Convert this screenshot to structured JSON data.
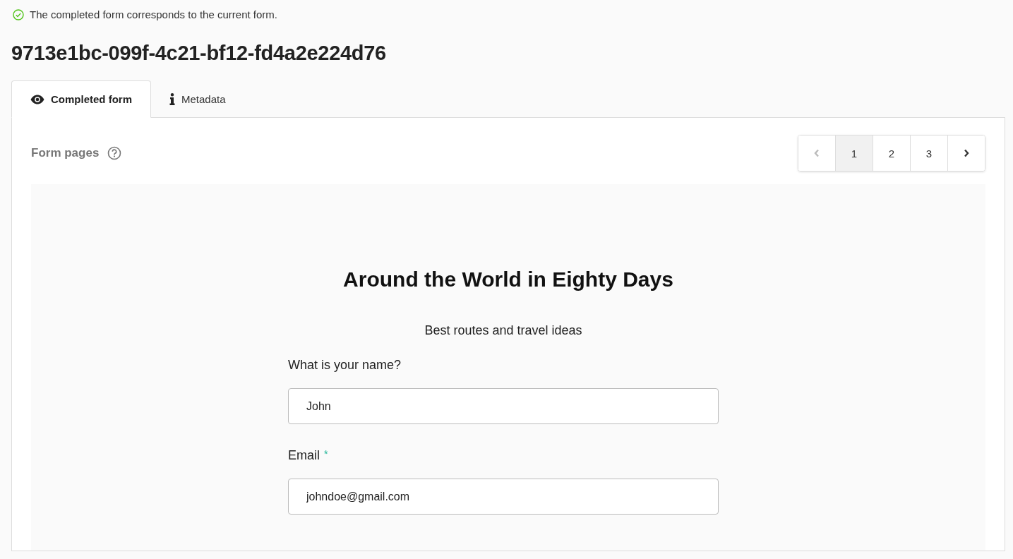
{
  "status": {
    "kind": "success",
    "text": "The completed form corresponds to the current form."
  },
  "title": "9713e1bc-099f-4c21-bf12-fd4a2e224d76",
  "tabs": [
    {
      "label": "Completed form",
      "kind": "eye",
      "selected": true
    },
    {
      "label": "Metadata",
      "kind": "info",
      "selected": false
    }
  ],
  "form_pages": {
    "label": "Form pages",
    "pagination": {
      "prev_disabled": true,
      "next_disabled": false,
      "pages": [
        {
          "label": "1",
          "selected": true
        },
        {
          "label": "2",
          "selected": false
        },
        {
          "label": "3",
          "selected": false
        }
      ]
    }
  },
  "form": {
    "title": "Around the World in Eighty Days",
    "subtitle": "Best routes and travel ideas",
    "questions": [
      {
        "kind": "text",
        "label": "What is your name?",
        "value": "John"
      },
      {
        "kind": "text",
        "label": "Email",
        "required_mark": "*",
        "value": "johndoe@gmail.com"
      }
    ]
  }
}
